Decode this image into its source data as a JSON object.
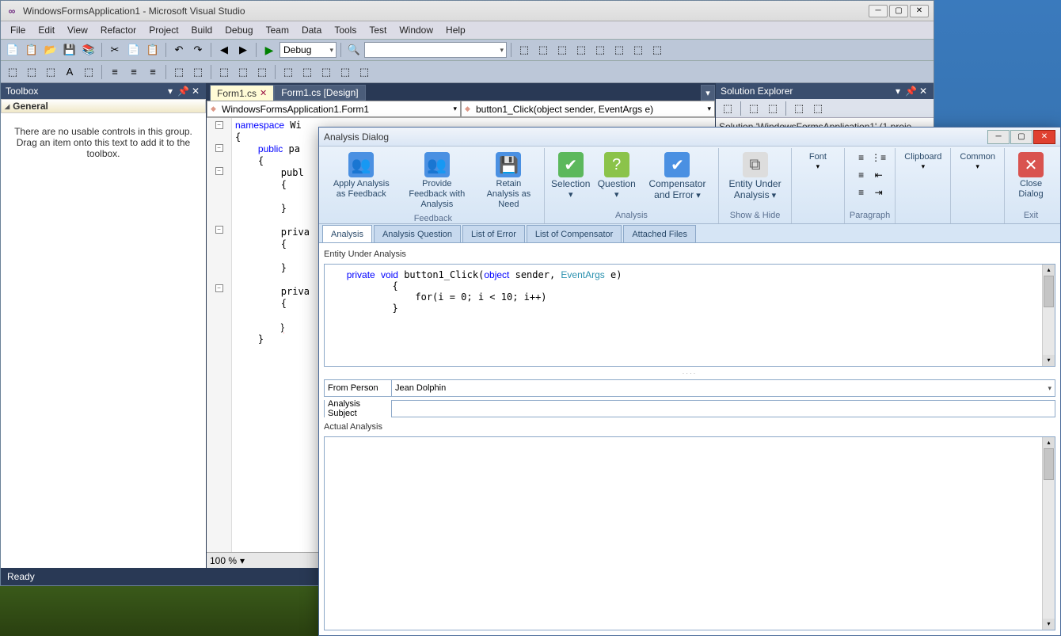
{
  "vs": {
    "title": "WindowsFormsApplication1 - Microsoft Visual Studio",
    "menubar": [
      "File",
      "Edit",
      "View",
      "Refactor",
      "Project",
      "Build",
      "Debug",
      "Team",
      "Data",
      "Tools",
      "Test",
      "Window",
      "Help"
    ],
    "config": "Debug",
    "statusbar": "Ready"
  },
  "toolbox": {
    "title": "Toolbox",
    "group": "General",
    "message": "There are no usable controls in this group. Drag an item onto this text to add it to the toolbox."
  },
  "tabs": {
    "active": "Form1.cs",
    "inactive": "Form1.cs [Design]"
  },
  "code_dropdowns": {
    "left": "WindowsFormsApplication1.Form1",
    "right": "button1_Click(object sender, EventArgs e)"
  },
  "code": {
    "ns_line": "namespace Wi",
    "pub_partial": "public pa",
    "publ": "publ",
    "priva1": "priva",
    "priva2": "priva"
  },
  "zoom": "100 %",
  "solexp": {
    "title": "Solution Explorer",
    "root": "Solution 'WindowsFormsApplication1' (1 proje"
  },
  "dialog": {
    "title": "Analysis Dialog",
    "ribbon": {
      "apply": "Apply Analysis as Feedback",
      "provide": "Provide Feedback with Analysis",
      "retain": "Retain Analysis as Need",
      "feedback_group": "Feedback",
      "selection": "Selection",
      "question": "Question",
      "compensator": "Compensator and Error",
      "analysis_group": "Analysis",
      "entity": "Entity Under Analysis",
      "showhide": "Show & Hide",
      "font": "Font",
      "paragraph": "Paragraph",
      "clipboard": "Clipboard",
      "common": "Common",
      "close": "Close Dialog",
      "exit": "Exit"
    },
    "tabs": [
      "Analysis",
      "Analysis Question",
      "List of Error",
      "List of Compensator",
      "Attached Files"
    ],
    "entity_label": "Entity Under Analysis",
    "code_sig": "private void button1_Click(object sender, EventArgs e)",
    "code_body_open": "        {",
    "code_for": "            for(i = 0; i < 10; i++)",
    "code_body_close": "        }",
    "from_person_label": "From Person",
    "from_person_value": "Jean Dolphin",
    "subject_label": "Analysis Subject",
    "actual_label": "Actual Analysis"
  }
}
